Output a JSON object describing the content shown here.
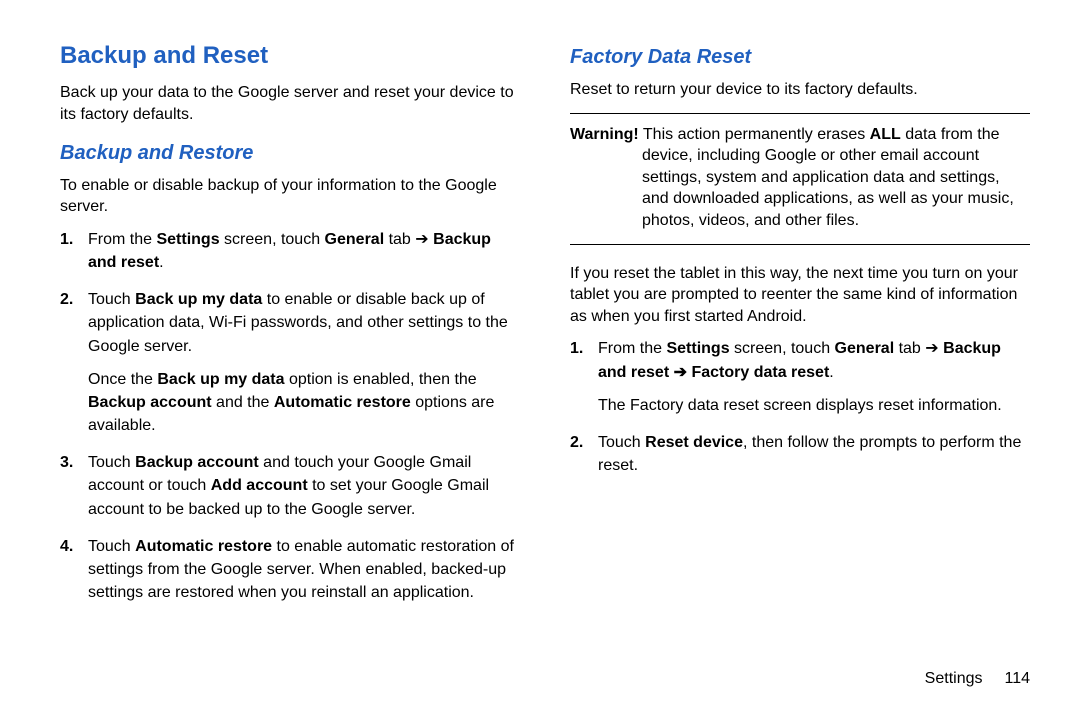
{
  "left": {
    "heading": "Backup and Reset",
    "intro": "Back up your data to the Google server and reset your device to its factory defaults.",
    "sub1_heading": "Backup and Restore",
    "sub1_intro": "To enable or disable backup of your information to the Google server.",
    "steps": {
      "s1": {
        "num": "1.",
        "t1_a": "From the ",
        "t1_b": "Settings",
        "t1_c": " screen, touch ",
        "t1_d": "General",
        "t1_e": " tab ",
        "arrow": "➔",
        "t1_f": "Backup and reset",
        "t1_g": "."
      },
      "s2": {
        "num": "2.",
        "t_a": "Touch ",
        "t_b": "Back up my data",
        "t_c": " to enable or disable back up of application data, Wi-Fi passwords, and other settings to the Google server.",
        "p2_a": "Once the ",
        "p2_b": "Back up my data",
        "p2_c": " option is enabled, then the ",
        "p2_d": "Backup account",
        "p2_e": " and the ",
        "p2_f": "Automatic restore",
        "p2_g": " options are available."
      },
      "s3": {
        "num": "3.",
        "t_a": "Touch ",
        "t_b": "Backup account",
        "t_c": " and touch your Google Gmail account or touch ",
        "t_d": "Add account",
        "t_e": " to set your Google Gmail account to be backed up to the Google server."
      },
      "s4": {
        "num": "4.",
        "t_a": "Touch ",
        "t_b": "Automatic restore",
        "t_c": " to enable automatic restoration of settings from the Google server. When enabled, backed-up settings are restored when you reinstall an application."
      }
    }
  },
  "right": {
    "heading": "Factory Data Reset",
    "intro": "Reset to return your device to its factory defaults.",
    "warn": {
      "label": "Warning!",
      "t_a": " This action permanently erases ",
      "t_b": "ALL",
      "t_c": " data from the device, including Google or other email account settings, system and application data and settings, and downloaded applications, as well as your music, photos, videos, and other files."
    },
    "after": "If you reset the tablet in this way, the next time you turn on your tablet you are prompted to reenter the same kind of information as when you first started Android.",
    "steps": {
      "s1": {
        "num": "1.",
        "t_a": "From the ",
        "t_b": "Settings",
        "t_c": " screen, touch ",
        "t_d": "General",
        "t_e": " tab ",
        "arrow": "➔",
        "t_f": "Backup and reset ",
        "arrow2": "➔",
        "t_g": " Factory data reset",
        "t_h": ".",
        "sub": "The Factory data reset screen displays reset information."
      },
      "s2": {
        "num": "2.",
        "t_a": "Touch ",
        "t_b": "Reset device",
        "t_c": ", then follow the prompts to perform the reset."
      }
    }
  },
  "footer": {
    "section": "Settings",
    "page": "114"
  }
}
